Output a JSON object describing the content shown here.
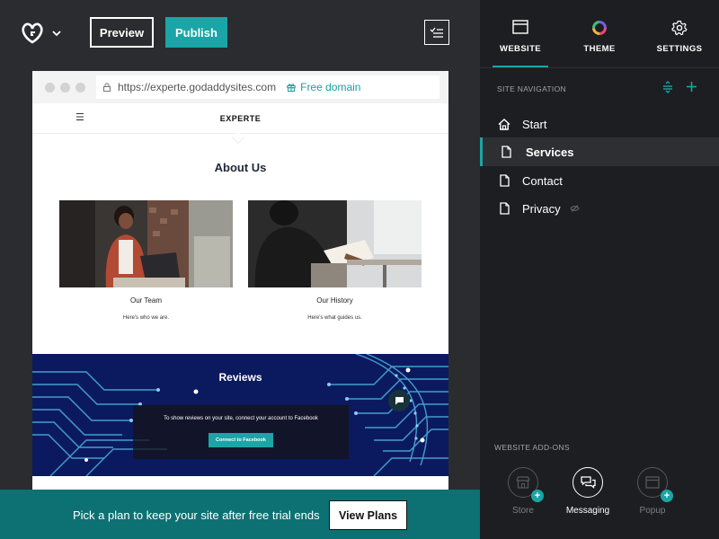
{
  "topbar": {
    "preview_label": "Preview",
    "publish_label": "Publish"
  },
  "browser": {
    "url": "https://experte.godaddysites.com",
    "free_domain_label": "Free domain"
  },
  "site": {
    "title": "EXPERTE",
    "about_title": "About Us",
    "cards": [
      {
        "caption": "Our Team",
        "subtitle": "Here's who we are."
      },
      {
        "caption": "Our History",
        "subtitle": "Here's what guides us."
      }
    ],
    "reviews_title": "Reviews",
    "reviews_message": "To show reviews on your site, connect your account to Facebook",
    "reviews_button": "Connect to Facebook"
  },
  "banner": {
    "text": "Pick a plan to keep your site after free trial ends",
    "button": "View Plans"
  },
  "panel": {
    "tabs": [
      {
        "label": "WEBSITE",
        "icon": "window-icon",
        "active": true
      },
      {
        "label": "THEME",
        "icon": "color-wheel-icon",
        "active": false
      },
      {
        "label": "SETTINGS",
        "icon": "gear-icon",
        "active": false
      }
    ],
    "nav_heading": "SITE NAVIGATION",
    "nav_items": [
      {
        "label": "Start",
        "icon": "home-icon",
        "selected": false,
        "hidden": false
      },
      {
        "label": "Services",
        "icon": "page-icon",
        "selected": true,
        "hidden": false
      },
      {
        "label": "Contact",
        "icon": "page-icon",
        "selected": false,
        "hidden": false
      },
      {
        "label": "Privacy",
        "icon": "page-icon",
        "selected": false,
        "hidden": true
      }
    ],
    "addons_heading": "WEBSITE ADD-ONS",
    "addons": [
      {
        "label": "Store",
        "icon": "store-icon",
        "enabled": false
      },
      {
        "label": "Messaging",
        "icon": "messaging-icon",
        "enabled": true
      },
      {
        "label": "Popup",
        "icon": "popup-icon",
        "enabled": false
      }
    ]
  },
  "colors": {
    "accent": "#1aa5a6",
    "banner": "#0d7173",
    "panel": "#1d1e21",
    "canvas": "#2b2c2f"
  }
}
